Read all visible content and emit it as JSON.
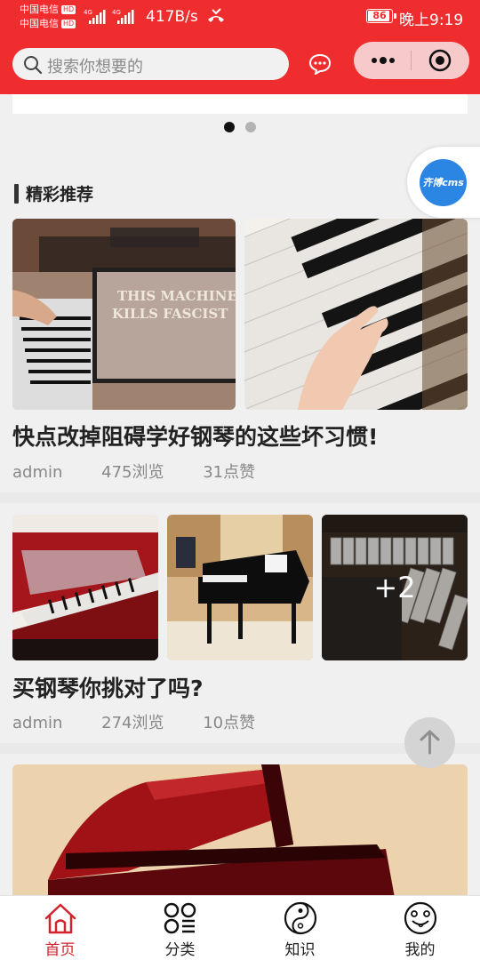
{
  "status_bar": {
    "carrier1": "中国电信",
    "carrier2": "中国电信",
    "hd": "HD",
    "net_speed": "417B/s",
    "battery": "86",
    "time": "晚上9:19"
  },
  "header": {
    "search_placeholder": "搜索你想要的",
    "icons": [
      "search-icon",
      "chat-icon",
      "more-dots-icon",
      "close-target-icon"
    ]
  },
  "carousel": {
    "indicator_count": 2,
    "active_index": 0
  },
  "section": {
    "title": "精彩推荐"
  },
  "float_logo": {
    "text": "齐博cms"
  },
  "posts": [
    {
      "title": "快点改掉阻碍学好钢琴的这些坏习惯!",
      "author": "admin",
      "views": "475浏览",
      "likes": "31点赞",
      "image_text": [
        "THIS MACHINE",
        "KILLS FASCIST"
      ]
    },
    {
      "title": "买钢琴你挑对了吗?",
      "author": "admin",
      "views": "274浏览",
      "likes": "10点赞",
      "more_images": "+2"
    }
  ],
  "tabs": [
    {
      "label": "首页",
      "icon": "home-icon",
      "active": true
    },
    {
      "label": "分类",
      "icon": "category-icon",
      "active": false
    },
    {
      "label": "知识",
      "icon": "yinyang-icon",
      "active": false
    },
    {
      "label": "我的",
      "icon": "smiley-icon",
      "active": false
    }
  ],
  "colors": {
    "primary": "#ef2d2f",
    "active_tab": "#d2232a"
  }
}
